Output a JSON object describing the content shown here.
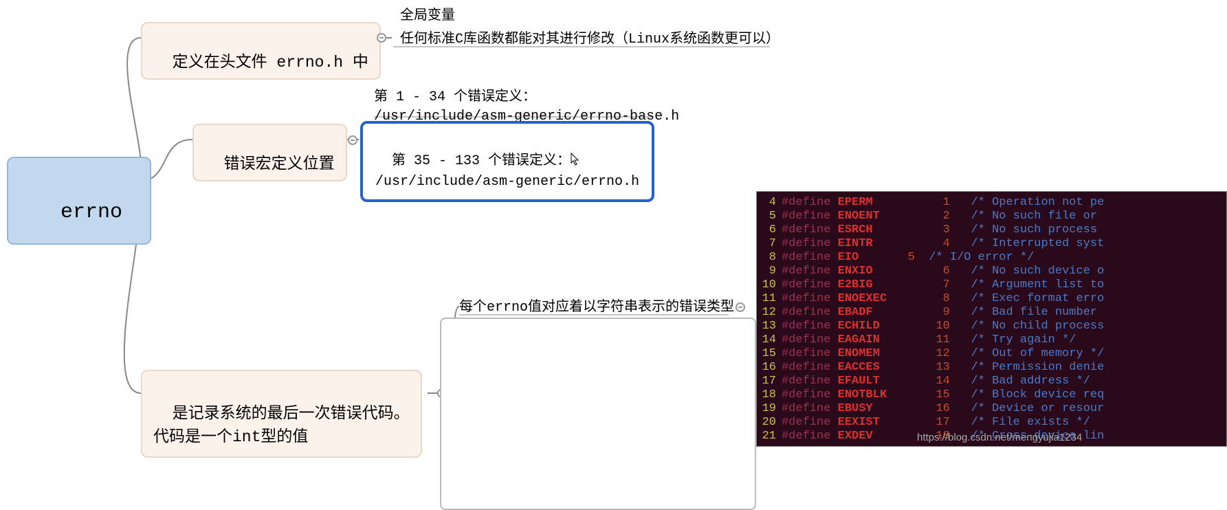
{
  "root": {
    "label": "errno"
  },
  "nodes": {
    "header_def": "定义在头文件 errno.h 中",
    "macro_pos": "错误宏定义位置",
    "last_err": "是记录系统的最后一次错误代码。\n代码是一个int型的值"
  },
  "child_labels": {
    "global_var": "全局变量",
    "modify_text": "任何标准C库函数都能对其进行修改（Linux系统函数更可以）",
    "range1": "第 1 - 34 个错误定义：\n/usr/include/asm-generic/errno-base.h",
    "range2": "第 35 - 133 个错误定义：\n/usr/include/asm-generic/errno.h",
    "err_type": "每个errno值对应着以字符串表示的错误类型"
  },
  "terminal": {
    "rows": [
      {
        "ln": "4",
        "macro": "EPERM",
        "num": "1",
        "cmt": "/* Operation not pe"
      },
      {
        "ln": "5",
        "macro": "ENOENT",
        "num": "2",
        "cmt": "/* No such file or "
      },
      {
        "ln": "6",
        "macro": "ESRCH",
        "num": "3",
        "cmt": "/* No such process "
      },
      {
        "ln": "7",
        "macro": "EINTR",
        "num": "4",
        "cmt": "/* Interrupted syst"
      },
      {
        "ln": "8",
        "macro": "EIO",
        "num": "5",
        "cmt": "/* I/O error */",
        "numshift": true
      },
      {
        "ln": "9",
        "macro": "ENXIO",
        "num": "6",
        "cmt": "/* No such device o"
      },
      {
        "ln": "10",
        "macro": "E2BIG",
        "num": "7",
        "cmt": "/* Argument list to"
      },
      {
        "ln": "11",
        "macro": "ENOEXEC",
        "num": "8",
        "cmt": "/* Exec format erro"
      },
      {
        "ln": "12",
        "macro": "EBADF",
        "num": "9",
        "cmt": "/* Bad file number "
      },
      {
        "ln": "13",
        "macro": "ECHILD",
        "num": "10",
        "cmt": "/* No child process"
      },
      {
        "ln": "14",
        "macro": "EAGAIN",
        "num": "11",
        "cmt": "/* Try again */"
      },
      {
        "ln": "15",
        "macro": "ENOMEM",
        "num": "12",
        "cmt": "/* Out of memory */"
      },
      {
        "ln": "16",
        "macro": "EACCES",
        "num": "13",
        "cmt": "/* Permission denie"
      },
      {
        "ln": "17",
        "macro": "EFAULT",
        "num": "14",
        "cmt": "/* Bad address */"
      },
      {
        "ln": "18",
        "macro": "ENOTBLK",
        "num": "15",
        "cmt": "/* Block device req"
      },
      {
        "ln": "19",
        "macro": "EBUSY",
        "num": "16",
        "cmt": "/* Device or resour"
      },
      {
        "ln": "20",
        "macro": "EEXIST",
        "num": "17",
        "cmt": "/* File exists */"
      },
      {
        "ln": "21",
        "macro": "EXDEV",
        "num": "18",
        "cmt": "/* Cross-device lin"
      }
    ]
  },
  "watermark": "https://blog.csdn.net/mengyujia1234"
}
